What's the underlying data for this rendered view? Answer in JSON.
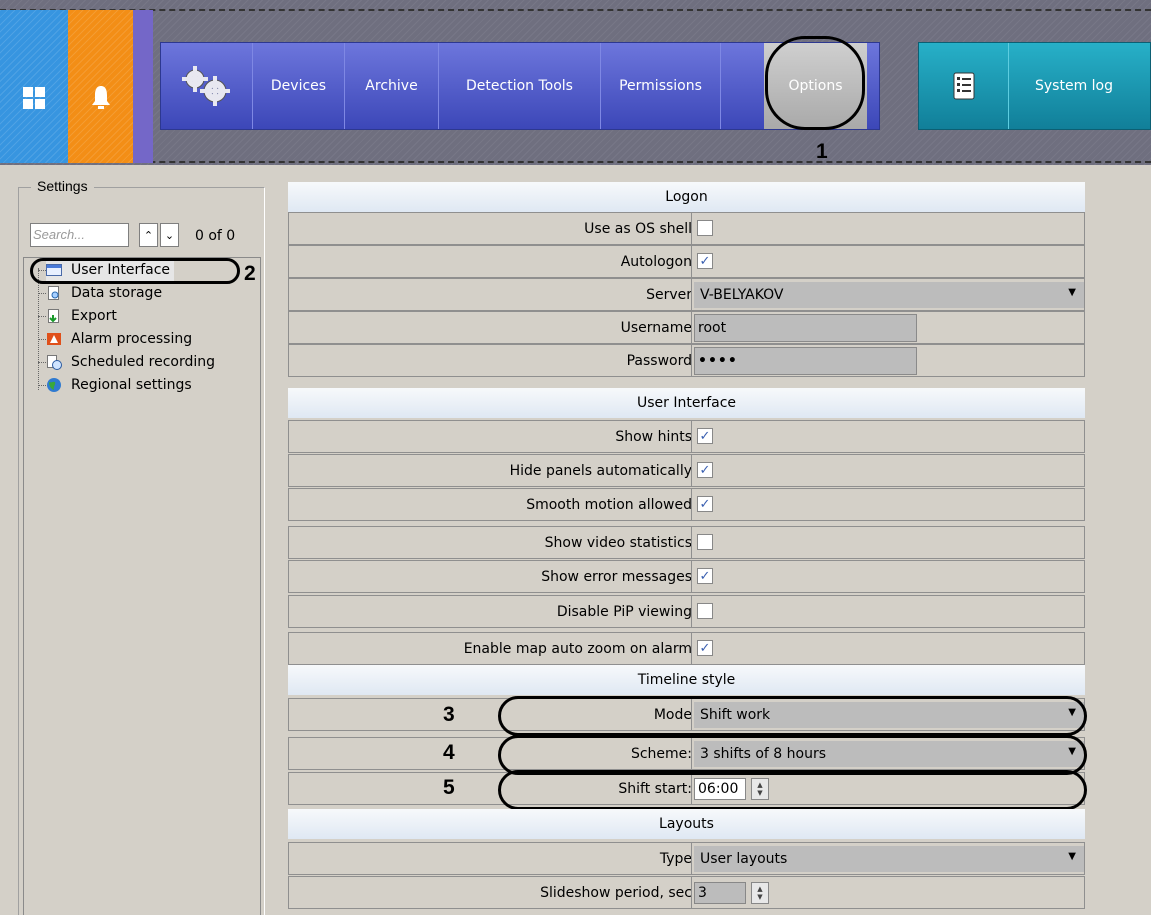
{
  "nav": {
    "items": [
      "Devices",
      "Archive",
      "Detection Tools",
      "Permissions",
      "Options"
    ],
    "system_log": "System log"
  },
  "annotations": [
    "1",
    "2",
    "3",
    "4",
    "5"
  ],
  "settings": {
    "title": "Settings",
    "search_placeholder": "Search...",
    "count": "0 of 0",
    "tree": [
      "User Interface",
      "Data storage",
      "Export",
      "Alarm processing",
      "Scheduled recording",
      "Regional settings"
    ]
  },
  "sections": {
    "logon": "Logon",
    "user_interface": "User Interface",
    "timeline": "Timeline style",
    "layouts": "Layouts"
  },
  "logon": {
    "os_shell_label": "Use as OS shell",
    "os_shell": false,
    "autologon_label": "Autologon",
    "autologon": true,
    "server_label": "Server",
    "server": "V-BELYAKOV",
    "username_label": "Username",
    "username": "root",
    "password_label": "Password",
    "password": "••••"
  },
  "ui": [
    {
      "label": "Show hints",
      "checked": true
    },
    {
      "label": "Hide panels automatically",
      "checked": true
    },
    {
      "label": "Smooth motion allowed",
      "checked": true
    },
    {
      "label": "Show video statistics",
      "checked": false
    },
    {
      "label": "Show error messages",
      "checked": true
    },
    {
      "label": "Disable PiP viewing",
      "checked": false
    },
    {
      "label": "Enable map auto zoom on alarm",
      "checked": true
    }
  ],
  "timeline": {
    "mode_label": "Mode",
    "mode": "Shift work",
    "scheme_label": "Scheme:",
    "scheme": "3 shifts of 8 hours",
    "shift_label": "Shift start:",
    "shift": "06:00"
  },
  "layouts": {
    "type_label": "Type",
    "type": "User layouts",
    "slideshow_label": "Slideshow period, sec",
    "slideshow": "3"
  },
  "colors": {
    "tile_blue": "#3795e0",
    "tile_orange": "#f38e16",
    "nav_blue": "#4b57c8",
    "log_teal": "#1a98b2",
    "check_blue": "#3a5fb0"
  }
}
